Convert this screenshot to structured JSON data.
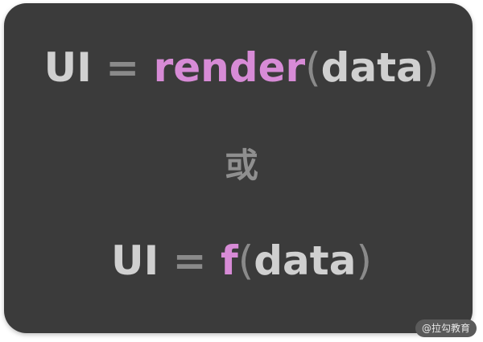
{
  "formula1": {
    "lhs": "UI",
    "eq": "=",
    "fn": "render",
    "open": "(",
    "arg": "data",
    "close": ")"
  },
  "separator": "或",
  "formula2": {
    "lhs": "UI",
    "eq": "=",
    "fn": "f",
    "open": "(",
    "arg": "data",
    "close": ")"
  },
  "watermark": "@拉勾教育",
  "colors": {
    "background": "#3b3b3b",
    "text": "#d0d0d0",
    "function": "#d78bd6",
    "muted": "#8a8a8a"
  }
}
